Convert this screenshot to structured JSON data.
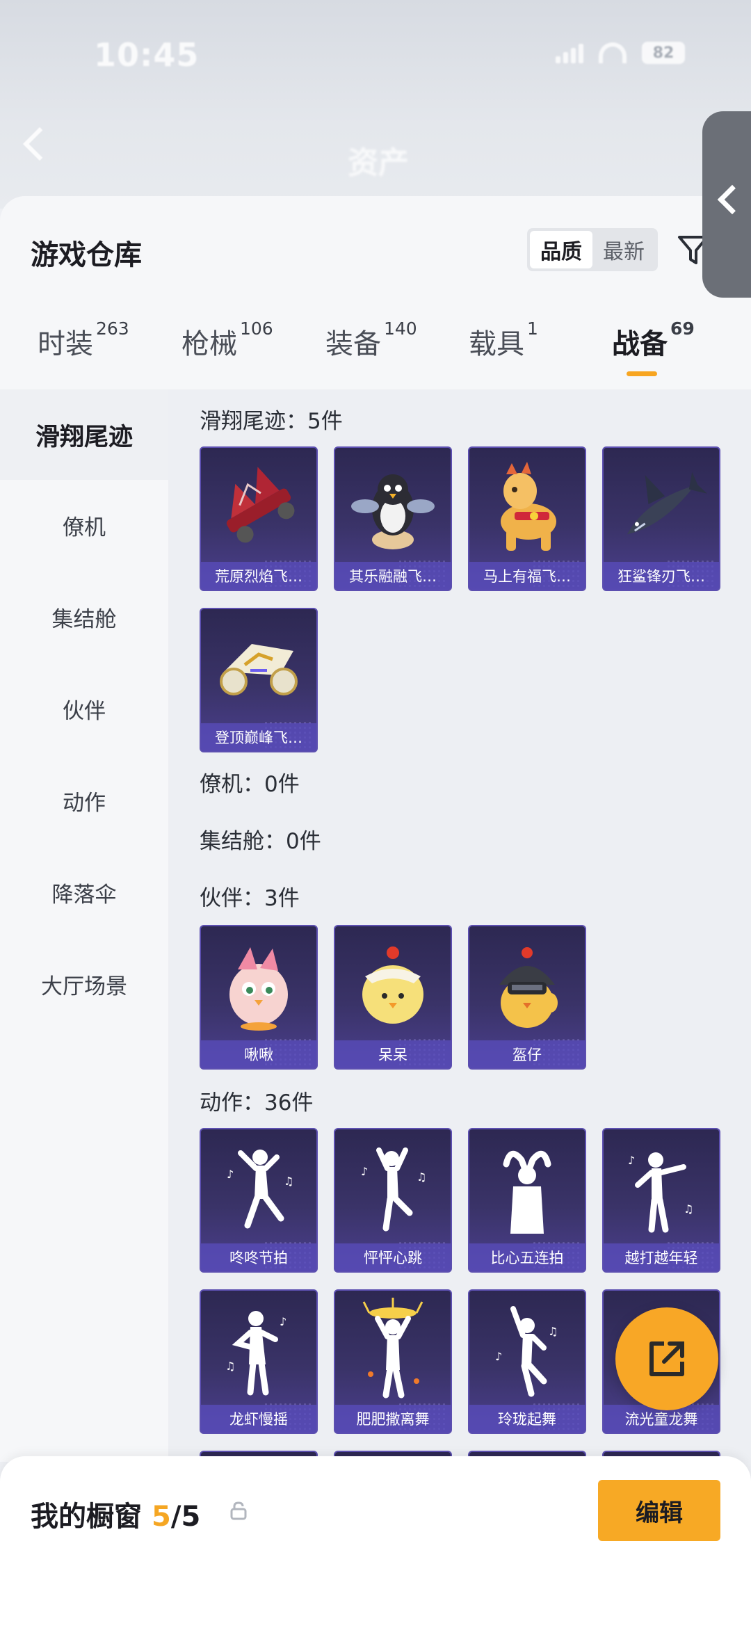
{
  "status_bar": {
    "time": "10:45",
    "battery": "82"
  },
  "background_header": {
    "title": "资产"
  },
  "sheet": {
    "title": "游戏仓库",
    "sort_options": [
      {
        "label": "品质",
        "active": true
      },
      {
        "label": "最新",
        "active": false
      }
    ]
  },
  "tabs": [
    {
      "label": "时装",
      "count": "263",
      "active": false
    },
    {
      "label": "枪械",
      "count": "106",
      "active": false
    },
    {
      "label": "装备",
      "count": "140",
      "active": false
    },
    {
      "label": "载具",
      "count": "1",
      "active": false
    },
    {
      "label": "战备",
      "count": "69",
      "active": true
    }
  ],
  "categories": [
    {
      "label": "滑翔尾迹",
      "active": true
    },
    {
      "label": "僚机",
      "active": false
    },
    {
      "label": "集结舱",
      "active": false
    },
    {
      "label": "伙伴",
      "active": false
    },
    {
      "label": "动作",
      "active": false
    },
    {
      "label": "降落伞",
      "active": false
    },
    {
      "label": "大厅场景",
      "active": false
    }
  ],
  "sections": [
    {
      "title": "滑翔尾迹：5件",
      "items": [
        "荒原烈焰飞…",
        "其乐融融飞…",
        "马上有福飞…",
        "狂鲨锋刃飞…",
        "登顶巅峰飞…"
      ]
    },
    {
      "title": "僚机：0件",
      "items": []
    },
    {
      "title": "集结舱：0件",
      "items": []
    },
    {
      "title": "伙伴：3件",
      "items": [
        "啾啾",
        "呆呆",
        "盔仔"
      ]
    },
    {
      "title": "动作：36件",
      "items": [
        "咚咚节拍",
        "怦怦心跳",
        "比心五连拍",
        "越打越年轻",
        "龙虾慢摇",
        "肥肥撒离舞",
        "玲珑起舞",
        "流光童龙舞"
      ]
    }
  ],
  "showcase": {
    "title": "我的橱窗",
    "current": "5",
    "separator": "/",
    "total": "5",
    "edit_label": "编辑"
  },
  "colors": {
    "accent": "#f7a925",
    "card_purple": "#3a3368"
  }
}
